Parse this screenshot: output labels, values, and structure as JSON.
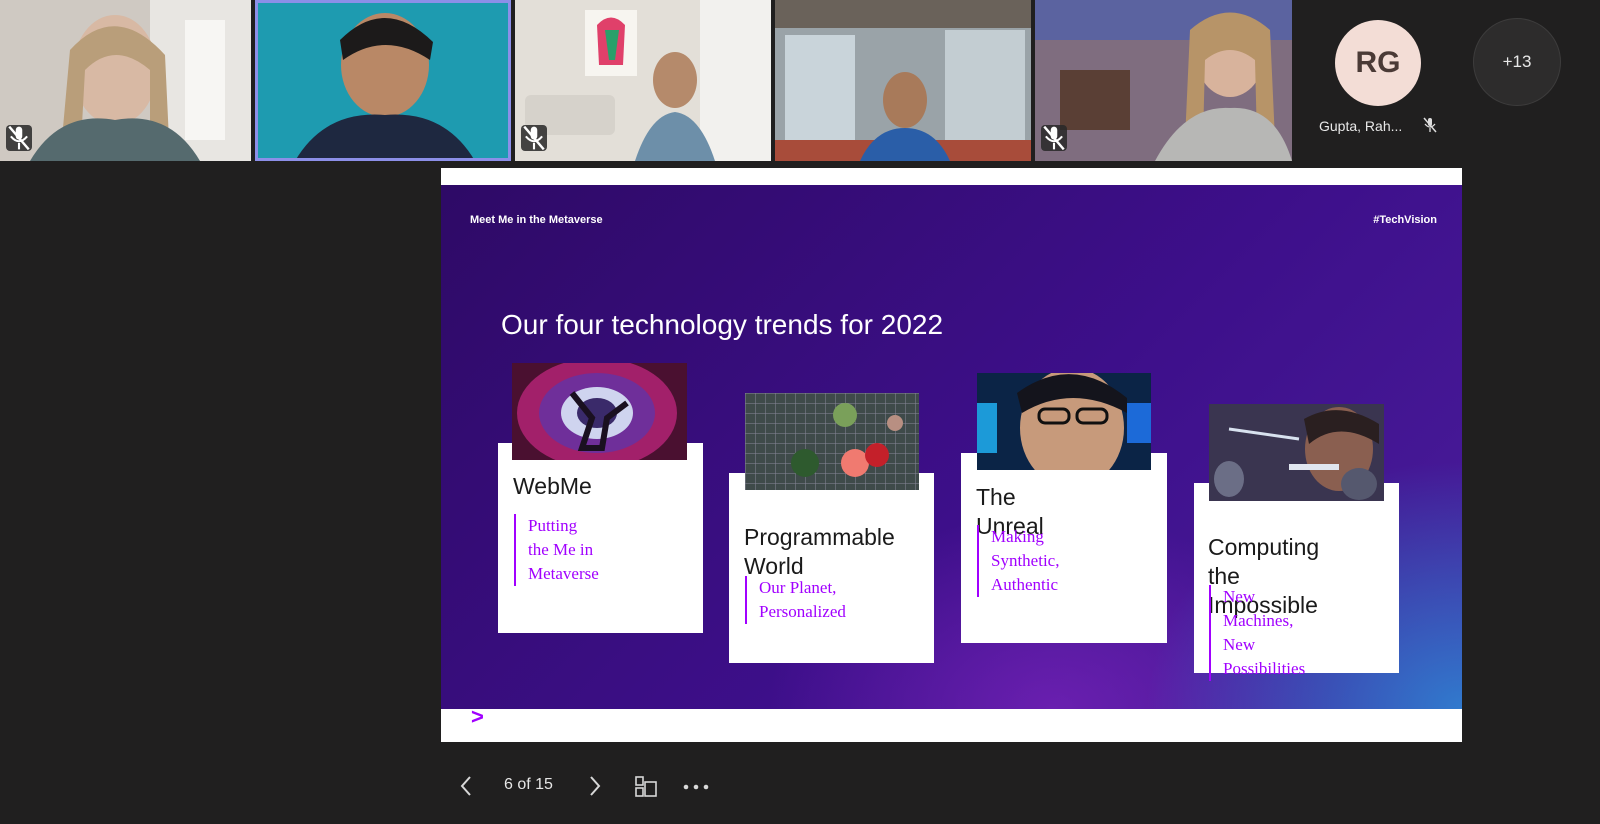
{
  "participants": [
    {
      "id": "p1",
      "muted": true,
      "active": false
    },
    {
      "id": "p2",
      "muted": false,
      "active": true
    },
    {
      "id": "p3",
      "muted": true,
      "active": false
    },
    {
      "id": "p4",
      "muted": false,
      "active": false
    },
    {
      "id": "p5",
      "muted": true,
      "active": false
    }
  ],
  "avatar_participant": {
    "initials": "RG",
    "name": "Gupta, Rah...",
    "muted": true
  },
  "more_participants": "+13",
  "slide": {
    "header_left": "Meet Me in the Metaverse",
    "header_right": "#TechVision",
    "title": "Our four technology trends for 2022",
    "cards": [
      {
        "title": "WebMe",
        "subtitle_lines": [
          "Putting",
          "the Me in",
          "Metaverse"
        ]
      },
      {
        "title_lines": [
          "Programmable",
          "World"
        ],
        "subtitle_lines": [
          "Our Planet,",
          "Personalized"
        ]
      },
      {
        "title": "The Unreal",
        "subtitle_lines": [
          "Making",
          "Synthetic,",
          "Authentic"
        ]
      },
      {
        "title_lines": [
          "Computing",
          "the Impossible"
        ],
        "subtitle_lines": [
          "New Machines,",
          "New Possibilities"
        ]
      }
    ],
    "brand_mark": ">"
  },
  "navigation": {
    "page_indicator": "6 of 15",
    "prev_icon": "chevron-left-icon",
    "next_icon": "chevron-right-icon",
    "view_icon": "slide-thumbnails-icon",
    "more_icon": "more-options-icon"
  },
  "colors": {
    "background": "#201f1f",
    "active_speaker": "#8c8fe8",
    "brand_purple": "#a100ff",
    "slide_purple": "#3d0f8a"
  }
}
